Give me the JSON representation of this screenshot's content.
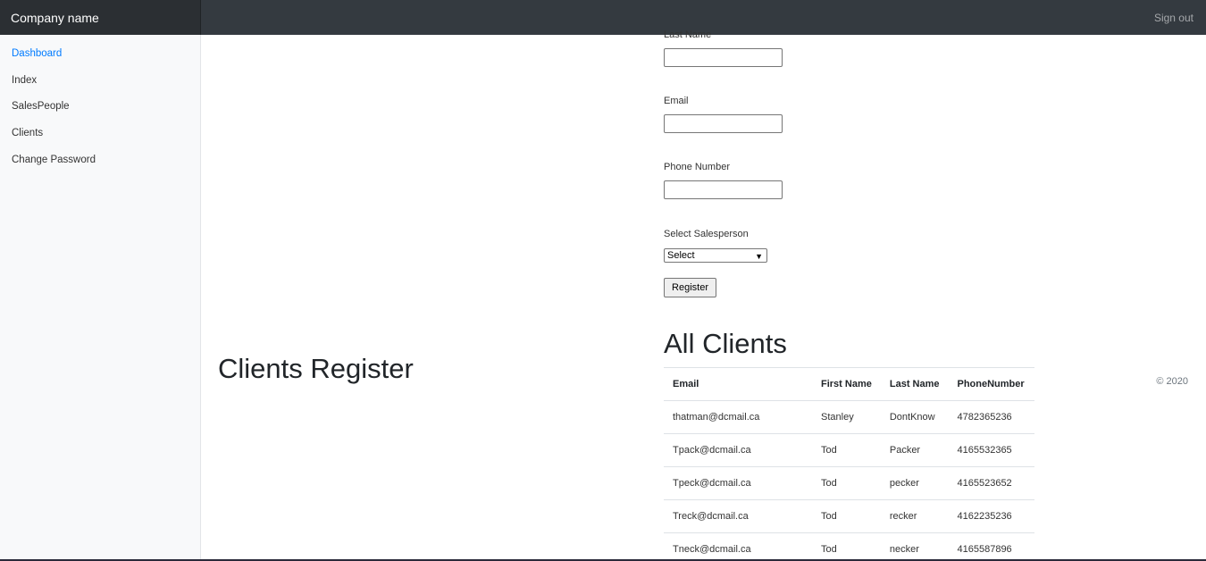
{
  "navbar": {
    "brand": "Company name",
    "signout": "Sign out"
  },
  "sidebar": {
    "items": [
      {
        "label": "Dashboard"
      },
      {
        "label": "Index"
      },
      {
        "label": "SalesPeople"
      },
      {
        "label": "Clients"
      },
      {
        "label": "Change Password"
      }
    ]
  },
  "colors": {
    "accent": "#007bff",
    "navbar": "#343a40",
    "sidebar": "#f8f9fa"
  },
  "main": {
    "page_title": "Clients Register",
    "form": {
      "last_name_label": "Last Name",
      "last_name_value": "",
      "email_label": "Email",
      "email_value": "",
      "phone_label": "Phone Number",
      "phone_value": "",
      "salesperson_label": "Select Salesperson",
      "salesperson_selected": "Select",
      "register_label": "Register"
    },
    "clients_title": "All Clients",
    "table": {
      "headers": [
        "Email",
        "First Name",
        "Last Name",
        "PhoneNumber"
      ],
      "rows": [
        [
          "thatman@dcmail.ca",
          "Stanley",
          "DontKnow",
          "4782365236"
        ],
        [
          "Tpack@dcmail.ca",
          "Tod",
          "Packer",
          "4165532365"
        ],
        [
          "Tpeck@dcmail.ca",
          "Tod",
          "pecker",
          "4165523652"
        ],
        [
          "Treck@dcmail.ca",
          "Tod",
          "recker",
          "4162235236"
        ],
        [
          "Tneck@dcmail.ca",
          "Tod",
          "necker",
          "4165587896"
        ]
      ]
    },
    "footer": "© 2020"
  }
}
